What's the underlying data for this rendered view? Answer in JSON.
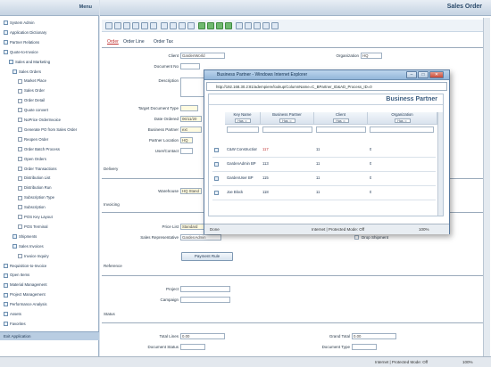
{
  "left_panel": {
    "title": "Menu",
    "items": [
      {
        "label": "System Admin",
        "type": "folder"
      },
      {
        "label": "Application Dictionary",
        "type": "folder"
      },
      {
        "label": "Partner Relations",
        "type": "folder"
      },
      {
        "label": "Quote-to-Invoice",
        "type": "folder"
      },
      {
        "label": "Sales and Marketing",
        "type": "folder"
      },
      {
        "label": "Sales Orders",
        "type": "folder"
      },
      {
        "label": "Market Place",
        "type": "doc"
      },
      {
        "label": "Sales Order",
        "type": "doc"
      },
      {
        "label": "Order Detail",
        "type": "doc"
      },
      {
        "label": "Quote convert",
        "type": "doc"
      },
      {
        "label": "NoPrice OrderInvoice",
        "type": "doc"
      },
      {
        "label": "Generate PO from Sales Order",
        "type": "doc"
      },
      {
        "label": "Reopen Order",
        "type": "doc"
      },
      {
        "label": "Order Batch Process",
        "type": "doc"
      },
      {
        "label": "Open Orders",
        "type": "doc"
      },
      {
        "label": "Order Transactions",
        "type": "doc"
      },
      {
        "label": "Distribution List",
        "type": "doc"
      },
      {
        "label": "Distribution Run",
        "type": "doc"
      },
      {
        "label": "Subscription Type",
        "type": "doc"
      },
      {
        "label": "Subscription",
        "type": "doc"
      },
      {
        "label": "POS Key Layout",
        "type": "doc"
      },
      {
        "label": "POS Terminal",
        "type": "doc"
      },
      {
        "label": "Shipments",
        "type": "folder"
      },
      {
        "label": "Sales Invoices",
        "type": "folder"
      },
      {
        "label": "Invoice Inquiry",
        "type": "doc"
      },
      {
        "label": "Requisition-to-Invoice",
        "type": "folder"
      },
      {
        "label": "Open Items",
        "type": "folder"
      },
      {
        "label": "Material Management",
        "type": "folder"
      },
      {
        "label": "Project Management",
        "type": "folder"
      },
      {
        "label": "Performance Analysis",
        "type": "folder"
      },
      {
        "label": "Assets",
        "type": "folder"
      },
      {
        "label": "Favorites",
        "type": "folder"
      }
    ],
    "footer": "Exit Application"
  },
  "main": {
    "title": "Sales Order",
    "tabs": [
      {
        "label": "Order",
        "active": true
      },
      {
        "label": "Order Line",
        "active": false
      },
      {
        "label": "Order Tax",
        "active": false
      }
    ],
    "fields": {
      "client_label": "Client",
      "client_value": "GardenWorld",
      "organization_label": "Organization",
      "organization_value": "HQ",
      "document_no_label": "Document No",
      "description_label": "Description",
      "target_doc_type_label": "Target Document Type",
      "date_ordered_label": "Date Ordered",
      "date_ordered_value": "06/11/20",
      "business_partner_label": "Business Partner",
      "business_partner_value": "ext",
      "partner_location_label": "Partner Location",
      "partner_location_value": "HQ",
      "user_contact_label": "User/Contact",
      "warehouse_label": "Warehouse",
      "warehouse_value": "HQ Stand",
      "price_list_label": "Price List",
      "price_list_value": "Standard",
      "sales_rep_label": "Sales Representative",
      "sales_rep_value": "GardenAdmin",
      "project_label": "Project",
      "campaign_label": "Campaign",
      "total_lines_label": "Total Lines",
      "total_lines_value": "0.00",
      "grand_total_label": "Grand Total",
      "grand_total_value": "0.00",
      "document_status_label": "Document Status",
      "document_type_label": "Document Type",
      "drop_shipment_label": "Drop Shipment"
    },
    "sections": {
      "delivery": "Delivery",
      "invoicing": "Invoicing",
      "reference": "Reference",
      "status": "Status"
    },
    "payment_rule_button": "Payment Rule"
  },
  "status_bar": {
    "zone": "Internet | Protected Mode: Off",
    "zoom": "100%"
  },
  "popup": {
    "window_title": "Business Partner - Windows Internet Explorer",
    "address": "http://192.168.30.2:81/adempiere/lookup/ColumnName=C_BPartner_ID&AD_Process_ID=0",
    "header": "Business Partner",
    "columns": [
      {
        "label": "Key Name",
        "filter": "Has :="
      },
      {
        "label": "Business Partner",
        "filter": "Has :="
      },
      {
        "label": "Client",
        "filter": "Has :="
      },
      {
        "label": "Organization",
        "filter": "Has :="
      }
    ],
    "rows": [
      [
        "C&W Construction",
        "117",
        "11",
        "0"
      ],
      [
        "GardenAdmin BP",
        "113",
        "11",
        "0"
      ],
      [
        "GardenUser BP",
        "115",
        "11",
        "0"
      ],
      [
        "Joe Block",
        "118",
        "11",
        "0"
      ]
    ],
    "status_left": "Done",
    "status_zone": "Internet | Protected Mode: Off",
    "status_zoom": "100%"
  }
}
